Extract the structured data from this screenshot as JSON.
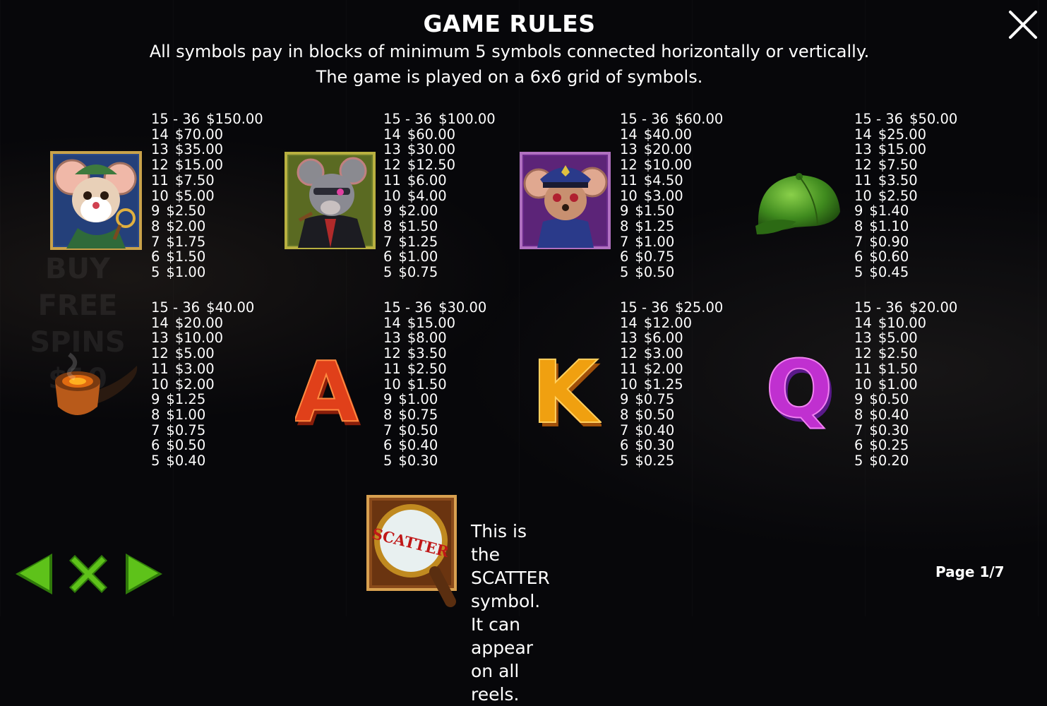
{
  "header": {
    "title": "GAME RULES",
    "line1": "All symbols pay in blocks of minimum 5 symbols connected horizontally or vertically.",
    "line2": "The game is played on a 6x6 grid of symbols."
  },
  "background": {
    "promo": [
      "BUY",
      "FREE",
      "SPINS",
      "$10"
    ]
  },
  "paytable": [
    {
      "symbol": "detective-mouse",
      "pays": [
        [
          "15 - 36",
          "$150.00"
        ],
        [
          "14",
          "$70.00"
        ],
        [
          "13",
          "$35.00"
        ],
        [
          "12",
          "$15.00"
        ],
        [
          "11",
          "$7.50"
        ],
        [
          "10",
          "$5.00"
        ],
        [
          "9",
          "$2.50"
        ],
        [
          "8",
          "$2.00"
        ],
        [
          "7",
          "$1.75"
        ],
        [
          "6",
          "$1.50"
        ],
        [
          "5",
          "$1.00"
        ]
      ]
    },
    {
      "symbol": "gangster-rat",
      "pays": [
        [
          "15 - 36",
          "$100.00"
        ],
        [
          "14",
          "$60.00"
        ],
        [
          "13",
          "$30.00"
        ],
        [
          "12",
          "$12.50"
        ],
        [
          "11",
          "$6.00"
        ],
        [
          "10",
          "$4.00"
        ],
        [
          "9",
          "$2.00"
        ],
        [
          "8",
          "$1.50"
        ],
        [
          "7",
          "$1.25"
        ],
        [
          "6",
          "$1.00"
        ],
        [
          "5",
          "$0.75"
        ]
      ]
    },
    {
      "symbol": "police-mouse",
      "pays": [
        [
          "15 - 36",
          "$60.00"
        ],
        [
          "14",
          "$40.00"
        ],
        [
          "13",
          "$20.00"
        ],
        [
          "12",
          "$10.00"
        ],
        [
          "11",
          "$4.50"
        ],
        [
          "10",
          "$3.00"
        ],
        [
          "9",
          "$1.50"
        ],
        [
          "8",
          "$1.25"
        ],
        [
          "7",
          "$1.00"
        ],
        [
          "6",
          "$0.75"
        ],
        [
          "5",
          "$0.50"
        ]
      ]
    },
    {
      "symbol": "green-cap",
      "pays": [
        [
          "15 - 36",
          "$50.00"
        ],
        [
          "14",
          "$25.00"
        ],
        [
          "13",
          "$15.00"
        ],
        [
          "12",
          "$7.50"
        ],
        [
          "11",
          "$3.50"
        ],
        [
          "10",
          "$2.50"
        ],
        [
          "9",
          "$1.40"
        ],
        [
          "8",
          "$1.10"
        ],
        [
          "7",
          "$0.90"
        ],
        [
          "6",
          "$0.60"
        ],
        [
          "5",
          "$0.45"
        ]
      ]
    },
    {
      "symbol": "pipe",
      "pays": [
        [
          "15 - 36",
          "$40.00"
        ],
        [
          "14",
          "$20.00"
        ],
        [
          "13",
          "$10.00"
        ],
        [
          "12",
          "$5.00"
        ],
        [
          "11",
          "$3.00"
        ],
        [
          "10",
          "$2.00"
        ],
        [
          "9",
          "$1.25"
        ],
        [
          "8",
          "$1.00"
        ],
        [
          "7",
          "$0.75"
        ],
        [
          "6",
          "$0.50"
        ],
        [
          "5",
          "$0.40"
        ]
      ]
    },
    {
      "symbol": "letter-a",
      "letter": "A",
      "pays": [
        [
          "15 - 36",
          "$30.00"
        ],
        [
          "14",
          "$15.00"
        ],
        [
          "13",
          "$8.00"
        ],
        [
          "12",
          "$3.50"
        ],
        [
          "11",
          "$2.50"
        ],
        [
          "10",
          "$1.50"
        ],
        [
          "9",
          "$1.00"
        ],
        [
          "8",
          "$0.75"
        ],
        [
          "7",
          "$0.50"
        ],
        [
          "6",
          "$0.40"
        ],
        [
          "5",
          "$0.30"
        ]
      ]
    },
    {
      "symbol": "letter-k",
      "letter": "K",
      "pays": [
        [
          "15 - 36",
          "$25.00"
        ],
        [
          "14",
          "$12.00"
        ],
        [
          "13",
          "$6.00"
        ],
        [
          "12",
          "$3.00"
        ],
        [
          "11",
          "$2.00"
        ],
        [
          "10",
          "$1.25"
        ],
        [
          "9",
          "$0.75"
        ],
        [
          "8",
          "$0.50"
        ],
        [
          "7",
          "$0.40"
        ],
        [
          "6",
          "$0.30"
        ],
        [
          "5",
          "$0.25"
        ]
      ]
    },
    {
      "symbol": "letter-q",
      "letter": "Q",
      "pays": [
        [
          "15 - 36",
          "$20.00"
        ],
        [
          "14",
          "$10.00"
        ],
        [
          "13",
          "$5.00"
        ],
        [
          "12",
          "$2.50"
        ],
        [
          "11",
          "$1.50"
        ],
        [
          "10",
          "$1.00"
        ],
        [
          "9",
          "$0.50"
        ],
        [
          "8",
          "$0.40"
        ],
        [
          "7",
          "$0.30"
        ],
        [
          "6",
          "$0.25"
        ],
        [
          "5",
          "$0.20"
        ]
      ]
    }
  ],
  "scatter": {
    "badge": "SCATTER",
    "line1": "This is the SCATTER symbol.",
    "line2": "It can appear on all reels."
  },
  "footer": {
    "page": "Page 1/7"
  },
  "colors": {
    "nav_green": "#5ec21a",
    "nav_green_dark": "#2f7a0a",
    "text": "#ffffff"
  }
}
